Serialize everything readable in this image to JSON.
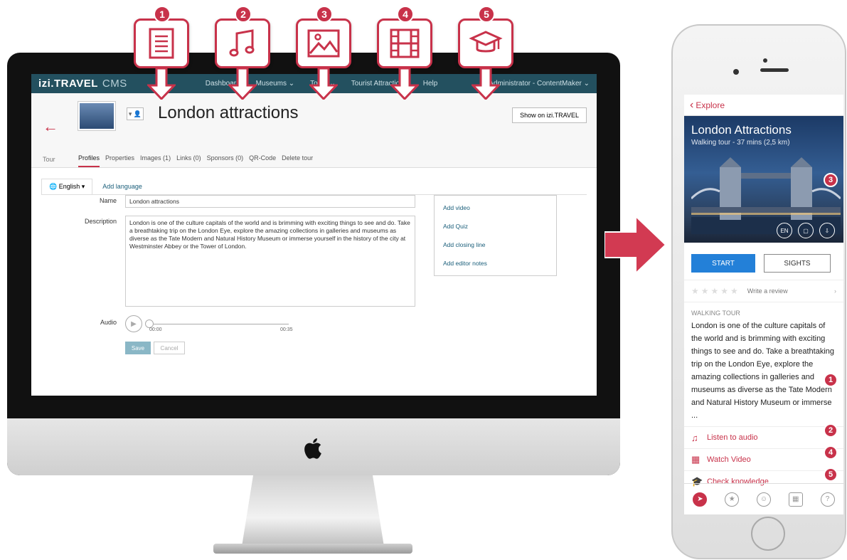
{
  "callouts": [
    {
      "num": "1",
      "icon": "document-icon"
    },
    {
      "num": "2",
      "icon": "music-note-icon"
    },
    {
      "num": "3",
      "icon": "image-icon"
    },
    {
      "num": "4",
      "icon": "film-icon"
    },
    {
      "num": "5",
      "icon": "graduation-cap-icon"
    }
  ],
  "cms": {
    "logo": "izi.TRAVEL",
    "logo_sub": "CMS",
    "nav": [
      "Dashboard",
      "Museums ⌄",
      "Tours ⌄",
      "Tourist Attractions",
      "Help"
    ],
    "user": "Administrator - ContentMaker ⌄",
    "tour_label": "Tour",
    "page_title": "London attractions",
    "show_button": "Show on izi.TRAVEL",
    "subtabs": [
      "Profiles",
      "Properties",
      "Images (1)",
      "Links (0)",
      "Sponsors (0)",
      "QR-Code",
      "Delete tour"
    ],
    "language": "English",
    "add_language": "Add language",
    "name_label": "Name",
    "name_value": "London attractions",
    "description_label": "Description",
    "description_value": "London is one of the culture capitals of the world and is brimming with exciting things to see and do. Take a breathtaking trip on the London Eye, explore the amazing collections in galleries and museums as diverse as the Tate Modern and Natural History Museum or immerse yourself in the history of the city at Westminster Abbey or the Tower of London.",
    "side_links": [
      "Add video",
      "Add Quiz",
      "Add closing line",
      "Add editor notes"
    ],
    "audio_label": "Audio",
    "audio_start": "00:00",
    "audio_end": "00:35",
    "save": "Save",
    "cancel": "Cancel"
  },
  "phone": {
    "back": "Explore",
    "title": "London Attractions",
    "subtitle": "Walking tour - 37 mins (2,5 km)",
    "hero_badges": [
      "EN",
      "",
      ""
    ],
    "start": "START",
    "sights": "SIGHTS",
    "stars": "★★★★★",
    "review": "Write a review",
    "section": "WALKING TOUR",
    "description": "London is one of the culture capitals of the world and is brimming with exciting things to see and do. Take a breathtaking trip on the London Eye, explore the amazing collections in galleries and museums as diverse as the Tate Modern and Natural History Museum or immerse ...",
    "actions": [
      "Listen to audio",
      "Watch Video",
      "Check knowledge"
    ],
    "badges": {
      "desc": "1",
      "audio": "2",
      "hero": "3",
      "video": "4",
      "quiz": "5"
    }
  },
  "colors": {
    "accent": "#c8324a",
    "cms_bar": "#23505f",
    "link": "#1a5e7a",
    "start": "#2380d8"
  }
}
